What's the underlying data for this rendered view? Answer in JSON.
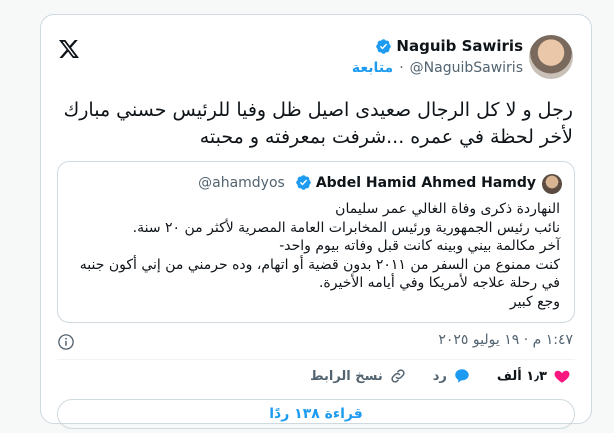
{
  "author": {
    "name": "Naguib Sawiris",
    "handle": "@NaguibSawiris",
    "follow_label": "متابعة"
  },
  "tweet": {
    "lines": [
      "رجل و لا كل الرجال صعيدى اصيل ظل وفيا للرئيس حسني مبارك",
      "لأخر لحظة في عمره ...شرفت بمعرفته و محبته"
    ]
  },
  "quoted": {
    "name": "Abdel Hamid Ahmed Hamdy",
    "handle": "@ahamdyos",
    "lines": [
      "النهاردة ذكرى وفاة الغالي عمر سليمان",
      "نائب رئيس الجمهورية ورئيس المخابرات العامة المصرية لأكثر من ٢٠ سنة.",
      "آخر مكالمة بيني وبينه كانت قبل وفاته بيوم واحد-",
      "كنت ممنوع من السفر من ٢٠١١ بدون قضية أو اتهام، وده حرمني من إني أكون جنبه",
      "في رحلة علاجه لأمريكا وفي أيامه الأخيرة.",
      "وجع كبير"
    ]
  },
  "timestamp": "١:٤٧ م · ١٩ يوليو ٢٠٢٥",
  "actions": {
    "likes_count": "١٫٣ ألف",
    "reply_label": "رد",
    "copy_link_label": "نسخ الرابط"
  },
  "read_replies_label": "قراءة ١٣٨ ردًا",
  "colors": {
    "accent": "#1d9bf0",
    "like": "#f91880",
    "verified": "#1d9bf0"
  }
}
